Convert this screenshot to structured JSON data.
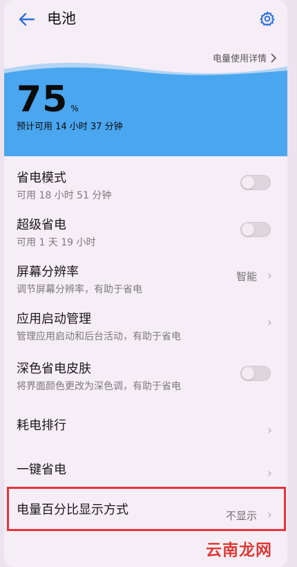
{
  "header": {
    "title": "电池"
  },
  "battery": {
    "usage_link": "电量使用详情",
    "percent": "75",
    "percent_symbol": "%",
    "estimate": "预计可用 14 小时 37 分钟"
  },
  "settings": [
    {
      "label": "省电模式",
      "sub": "可用 18 小时 51 分钟",
      "control": "toggle",
      "on": false
    },
    {
      "label": "超级省电",
      "sub": "可用 1 天 19 小时",
      "control": "toggle",
      "on": false
    },
    {
      "label": "屏幕分辨率",
      "sub": "调节屏幕分辨率，有助于省电",
      "control": "chevron",
      "value": "智能"
    },
    {
      "label": "应用启动管理",
      "sub": "管理应用启动和后台活动，有助于省电",
      "control": "chevron"
    },
    {
      "label": "深色省电皮肤",
      "sub": "将界面颜色更改为深色调，有助于省电",
      "control": "toggle",
      "on": false
    },
    {
      "label": "耗电排行",
      "control": "chevron"
    },
    {
      "label": "一键省电",
      "control": "chevron"
    },
    {
      "label": "电量百分比显示方式",
      "control": "chevron",
      "value": "不显示"
    }
  ],
  "watermark": "云南龙网",
  "colors": {
    "accent": "#2b6fd8",
    "wave": "#4aa6ee",
    "highlight": "#e8333a"
  },
  "icons": {
    "back": "arrow-left",
    "settings": "gear",
    "chevron": "chevron-right"
  }
}
